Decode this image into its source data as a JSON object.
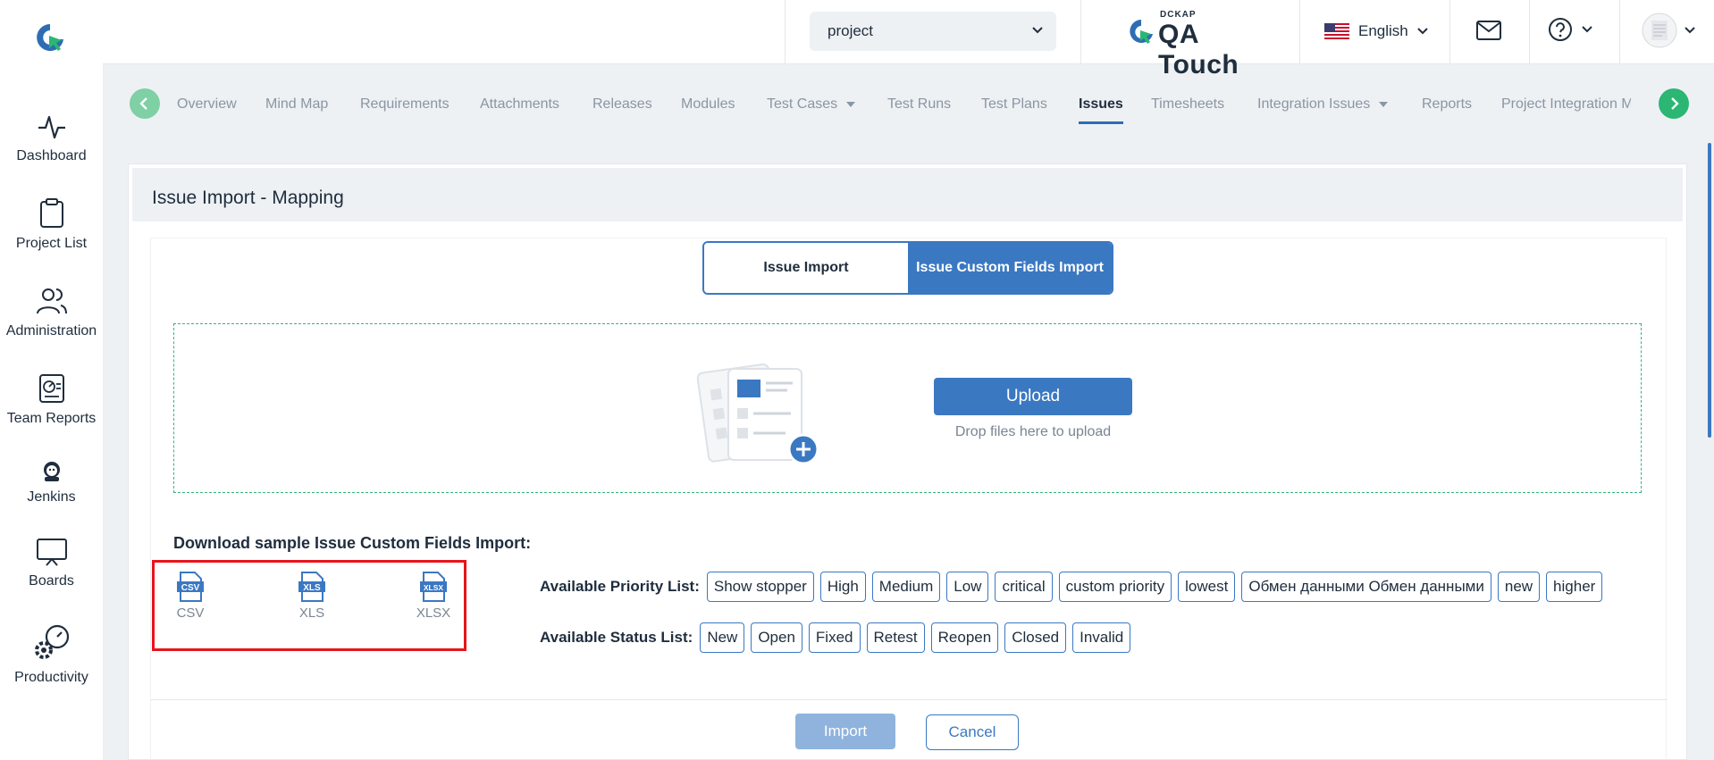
{
  "sidebar": {
    "items": [
      {
        "label": "Dashboard"
      },
      {
        "label": "Project List"
      },
      {
        "label": "Administration"
      },
      {
        "label": "Team Reports"
      },
      {
        "label": "Jenkins"
      },
      {
        "label": "Boards"
      },
      {
        "label": "Productivity"
      }
    ]
  },
  "header": {
    "project_value": "project",
    "brand_small": "DCKAP",
    "brand_name": "QA Touch",
    "language": "English"
  },
  "tabs": [
    {
      "label": "Overview"
    },
    {
      "label": "Mind Map"
    },
    {
      "label": "Requirements"
    },
    {
      "label": "Attachments"
    },
    {
      "label": "Releases"
    },
    {
      "label": "Modules"
    },
    {
      "label": "Test Cases"
    },
    {
      "label": "Test Runs"
    },
    {
      "label": "Test Plans"
    },
    {
      "label": "Issues"
    },
    {
      "label": "Timesheets"
    },
    {
      "label": "Integration Issues"
    },
    {
      "label": "Reports"
    },
    {
      "label": "Project Integration M"
    }
  ],
  "card": {
    "title": "Issue Import - Mapping",
    "toggle": {
      "left": "Issue Import",
      "right": "Issue Custom Fields Import"
    },
    "upload_label": "Upload",
    "drop_hint": "Drop files here to upload",
    "download_title": "Download sample Issue Custom Fields Import:",
    "files": [
      {
        "icon_text": "CSV",
        "label": "CSV"
      },
      {
        "icon_text": "XLS",
        "label": "XLS"
      },
      {
        "icon_text": "XLSX",
        "label": "XLSX"
      }
    ],
    "priority_label": "Available Priority List:",
    "priorities": [
      "Show stopper",
      "High",
      "Medium",
      "Low",
      "critical",
      "custom priority",
      "lowest",
      "Обмен данными Обмен данными",
      "new",
      "higher"
    ],
    "status_label": "Available Status List:",
    "statuses": [
      "New",
      "Open",
      "Fixed",
      "Retest",
      "Reopen",
      "Closed",
      "Invalid"
    ],
    "import_label": "Import",
    "cancel_label": "Cancel"
  },
  "colors": {
    "accent": "#3b78c2",
    "highlight": "#e8141b",
    "green": "#2bb673"
  }
}
